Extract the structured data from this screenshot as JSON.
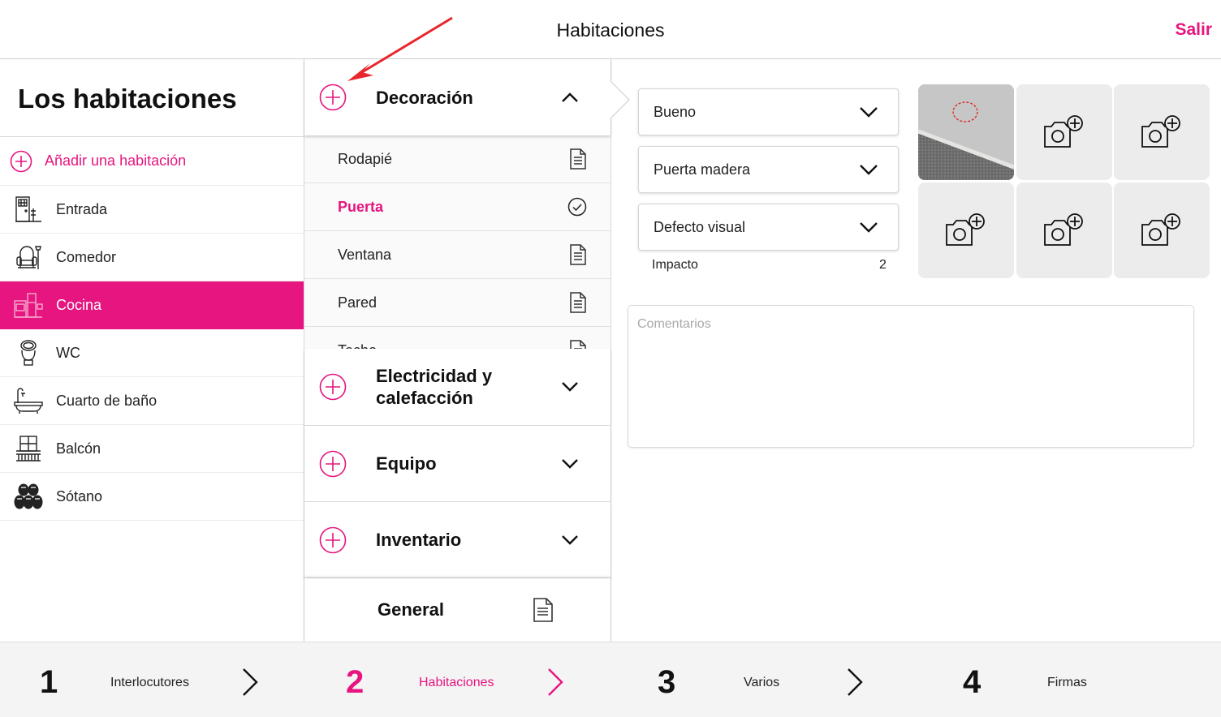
{
  "header": {
    "title": "Habitaciones",
    "exit_label": "Salir"
  },
  "rooms_panel": {
    "title": "Los habitaciones",
    "add_label": "Añadir una habitación",
    "items": [
      {
        "label": "Entrada",
        "icon": "entrance-icon"
      },
      {
        "label": "Comedor",
        "icon": "armchair-icon"
      },
      {
        "label": "Cocina",
        "icon": "kitchen-icon",
        "active": true
      },
      {
        "label": "WC",
        "icon": "toilet-icon"
      },
      {
        "label": "Cuarto de baño",
        "icon": "bathtub-icon"
      },
      {
        "label": "Balcón",
        "icon": "balcony-icon"
      },
      {
        "label": "Sótano",
        "icon": "barrels-icon"
      }
    ]
  },
  "categories": {
    "decoracion": {
      "label": "Decoración",
      "items": [
        {
          "label": "Rodapié",
          "status_icon": "document-icon"
        },
        {
          "label": "Puerta",
          "status_icon": "check-circle-icon",
          "selected": true
        },
        {
          "label": "Ventana",
          "status_icon": "document-icon"
        },
        {
          "label": "Pared",
          "status_icon": "document-icon"
        },
        {
          "label": "Techo",
          "status_icon": "document-icon"
        }
      ]
    },
    "electricidad": {
      "label_line1": "Electricidad y",
      "label_line2": "calefacción"
    },
    "equipo": {
      "label": "Equipo"
    },
    "inventario": {
      "label": "Inventario"
    },
    "general": {
      "label": "General"
    }
  },
  "detail": {
    "condition": "Bueno",
    "type": "Puerta madera",
    "defect": "Defecto visual",
    "impact_label": "Impacto",
    "impact_value": "2",
    "comments_placeholder": "Comentarios"
  },
  "photos": {
    "filled": 1,
    "total": 6
  },
  "steps": [
    {
      "number": "1",
      "label": "Interlocutores"
    },
    {
      "number": "2",
      "label": "Habitaciones",
      "active": true
    },
    {
      "number": "3",
      "label": "Varios"
    },
    {
      "number": "4",
      "label": "Firmas"
    }
  ],
  "colors": {
    "accent": "#e6157f",
    "annotation_arrow": "#e8262c",
    "text": "#111111",
    "panel_bg": "#f4f4f4"
  }
}
